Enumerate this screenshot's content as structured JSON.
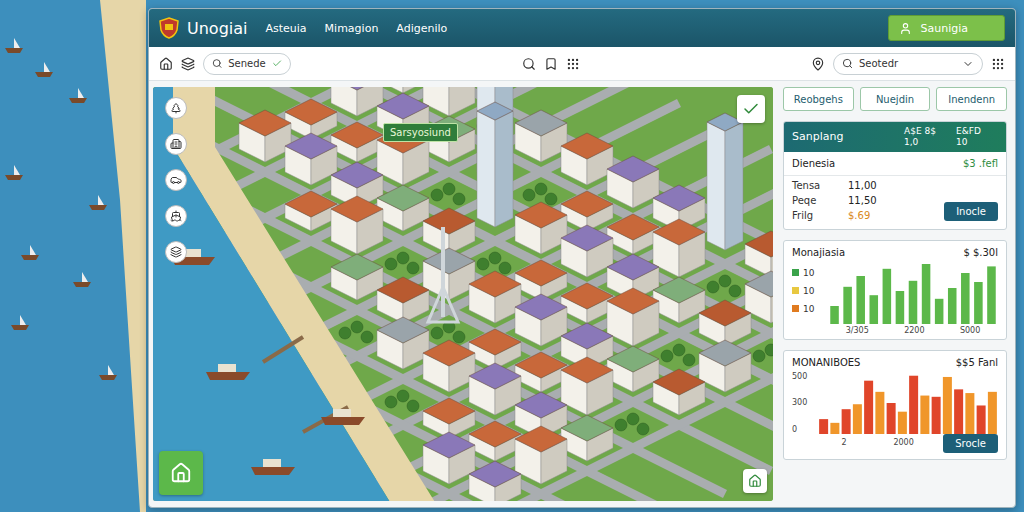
{
  "header": {
    "title": "Unogiai",
    "nav": [
      "Asteuia",
      "Mimagion",
      "Adigenilo"
    ],
    "account": "Saunigia"
  },
  "toolbar": {
    "search": "Senede",
    "select": "Seotedr"
  },
  "map": {
    "label": "Sarsyosiund"
  },
  "tabs": [
    {
      "label": "Reobgehs",
      "selected": false
    },
    {
      "label": "Nuejdin",
      "selected": false
    },
    {
      "label": "Inendenn",
      "selected": false
    }
  ],
  "summary": {
    "title": "Sanplang",
    "columns": [
      {
        "top": "A$E 8$",
        "bottom": "1,0"
      },
      {
        "top": "E&FD",
        "bottom": "10"
      }
    ],
    "total": {
      "label": "Dienesia",
      "value": "$3 .fefl"
    },
    "rows": [
      {
        "label": "Tensa",
        "value": "11,00",
        "color": "#222222"
      },
      {
        "label": "Peqe",
        "value": "11,50",
        "color": "#222222"
      },
      {
        "label": "Frilg",
        "value": "$.69",
        "color": "#d9891c"
      }
    ],
    "button": "Inocle"
  },
  "chart1": {
    "title": "Monajiasia",
    "value": "$ $.30l",
    "legend": [
      {
        "label": "10",
        "color": "#3aa34a"
      },
      {
        "label": "10",
        "color": "#e8c840"
      },
      {
        "label": "10",
        "color": "#e07b20"
      }
    ],
    "x_ticks": [
      "3/305",
      "2200",
      "S000"
    ],
    "series": [
      {
        "color": "#5cb84a",
        "values": [
          30,
          62,
          80,
          48,
          92,
          55,
          72,
          100,
          42,
          60,
          85,
          70,
          96
        ]
      }
    ]
  },
  "chart2": {
    "title": "MONANIBOES",
    "value": "$$5 Fanl",
    "y_ticks": [
      "500",
      "300",
      "0"
    ],
    "x_ticks": [
      "2",
      "2000"
    ],
    "series": [
      {
        "color": "#e0452a",
        "values": [
          120,
          200,
          430,
          250,
          470,
          300,
          360,
          230
        ]
      },
      {
        "color": "#f0962a",
        "values": [
          90,
          240,
          340,
          180,
          310,
          460,
          330,
          340
        ]
      }
    ],
    "button": "Srocle"
  }
}
